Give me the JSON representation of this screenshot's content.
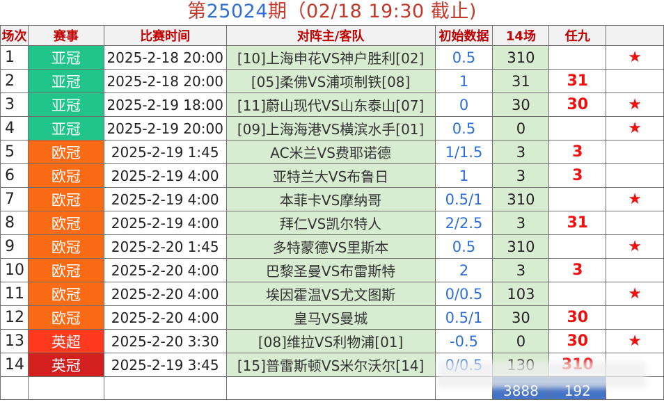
{
  "title": {
    "prefix": "第",
    "issue": "25024",
    "suffix": "期（02/18 19:30 截止)"
  },
  "headers": {
    "idx": "场次",
    "league": "赛事",
    "time": "比赛时间",
    "match": "对阵主/客队",
    "odds": "初始数据",
    "c14": "14场",
    "r9": "任九",
    "star": ""
  },
  "colors": {
    "acl": "#21c48a",
    "ucl": "#fb6a14",
    "epl": "#ff3a1e",
    "ec": "#d41f1f",
    "header_text": "#c00000",
    "match_bg": "#d7ecd0",
    "odds_text": "#2d6ed6",
    "pick_red": "#ef1111",
    "footer_blue": "#4472c4"
  },
  "star_icon": "red-star-icon",
  "rows": [
    {
      "idx": "1",
      "league": "亚冠",
      "lg": "acl",
      "time": "2025-2-18 20:00",
      "match": "[10]上海申花VS神户胜利[02]",
      "odds": "0.5",
      "c14": "310",
      "r9": "",
      "star": "★"
    },
    {
      "idx": "2",
      "league": "亚冠",
      "lg": "acl",
      "time": "2025-2-18 20:00",
      "match": "[05]柔佛VS浦项制铁[08]",
      "odds": "1",
      "c14": "31",
      "r9": "31",
      "star": ""
    },
    {
      "idx": "3",
      "league": "亚冠",
      "lg": "acl",
      "time": "2025-2-19 18:00",
      "match": "[11]蔚山现代VS山东泰山[07]",
      "odds": "0",
      "c14": "30",
      "r9": "30",
      "star": "★"
    },
    {
      "idx": "4",
      "league": "亚冠",
      "lg": "acl",
      "time": "2025-2-19 20:00",
      "match": "[09]上海海港VS横滨水手[01]",
      "odds": "0.5",
      "c14": "0",
      "r9": "",
      "star": "★"
    },
    {
      "idx": "5",
      "league": "欧冠",
      "lg": "ucl",
      "time": "2025-2-19 1:45",
      "match": "AC米兰VS费耶诺德",
      "odds": "1/1.5",
      "c14": "3",
      "r9": "3",
      "star": ""
    },
    {
      "idx": "6",
      "league": "欧冠",
      "lg": "ucl",
      "time": "2025-2-19 4:00",
      "match": "亚特兰大VS布鲁日",
      "odds": "1",
      "c14": "3",
      "r9": "3",
      "star": ""
    },
    {
      "idx": "7",
      "league": "欧冠",
      "lg": "ucl",
      "time": "2025-2-19 4:00",
      "match": "本菲卡VS摩纳哥",
      "odds": "0.5/1",
      "c14": "310",
      "r9": "",
      "star": "★"
    },
    {
      "idx": "8",
      "league": "欧冠",
      "lg": "ucl",
      "time": "2025-2-19 4:00",
      "match": "拜仁VS凯尔特人",
      "odds": "2/2.5",
      "c14": "3",
      "r9": "31",
      "star": ""
    },
    {
      "idx": "9",
      "league": "欧冠",
      "lg": "ucl",
      "time": "2025-2-20 1:45",
      "match": "多特蒙德VS里斯本",
      "odds": "0.5",
      "c14": "310",
      "r9": "",
      "star": "★"
    },
    {
      "idx": "10",
      "league": "欧冠",
      "lg": "ucl",
      "time": "2025-2-20 4:00",
      "match": "巴黎圣曼VS布雷斯特",
      "odds": "2",
      "c14": "3",
      "r9": "3",
      "star": ""
    },
    {
      "idx": "11",
      "league": "欧冠",
      "lg": "ucl",
      "time": "2025-2-20 4:00",
      "match": "埃因霍温VS尤文图斯",
      "odds": "0/0.5",
      "c14": "103",
      "r9": "",
      "star": "★"
    },
    {
      "idx": "12",
      "league": "欧冠",
      "lg": "ucl",
      "time": "2025-2-20 4:00",
      "match": "皇马VS曼城",
      "odds": "0.5/1",
      "c14": "30",
      "r9": "30",
      "star": ""
    },
    {
      "idx": "13",
      "league": "英超",
      "lg": "epl",
      "time": "2025-2-20 3:30",
      "match": "[08]维拉VS利物浦[01]",
      "odds": "-0.5",
      "c14": "0",
      "r9": "30",
      "star": "★"
    },
    {
      "idx": "14",
      "league": "英冠",
      "lg": "ec",
      "time": "2025-2-19 3:45",
      "match": "[15]普雷斯顿VS米尔沃尔[14]",
      "odds": "0/0.5",
      "c14": "130",
      "r9": "310",
      "star": ""
    }
  ],
  "footer": {
    "c14_total": "3888",
    "r9_total": "192"
  }
}
